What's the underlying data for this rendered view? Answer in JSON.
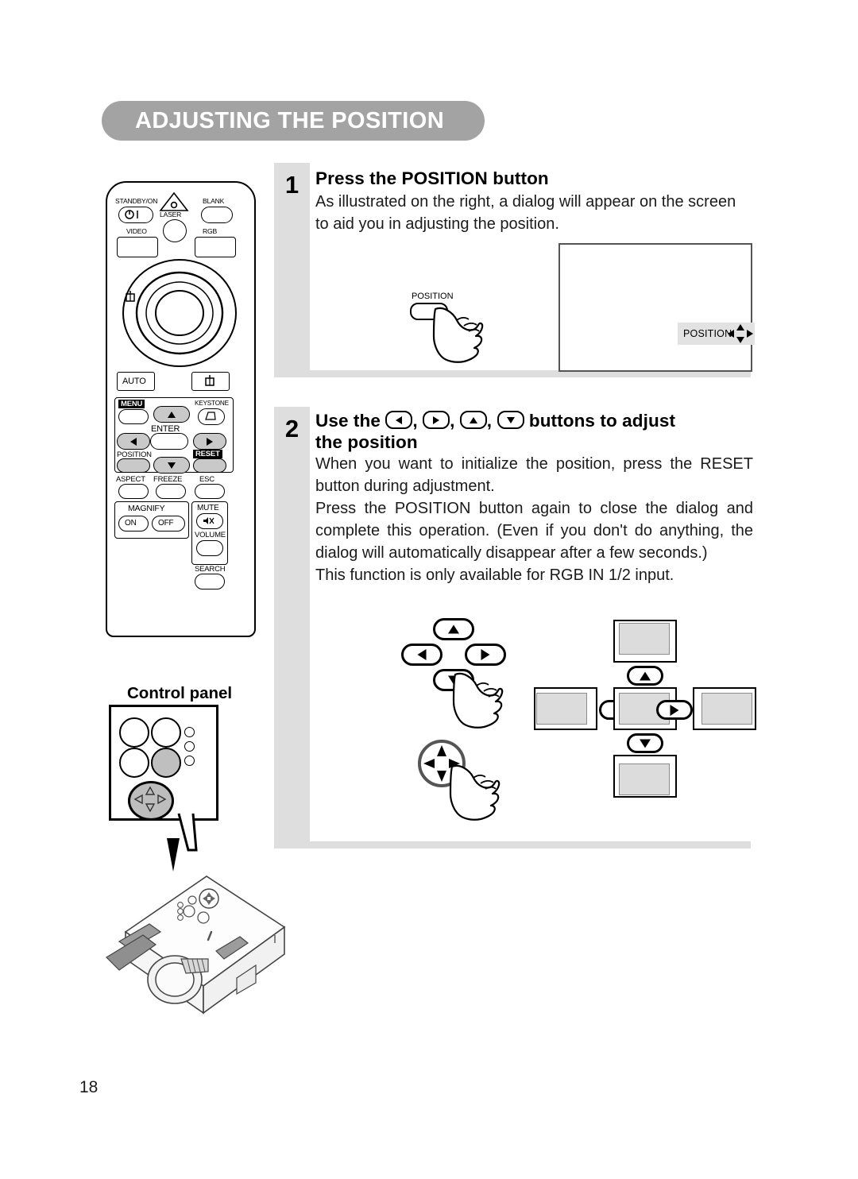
{
  "page": {
    "title": "ADJUSTING THE POSITION",
    "number": "18"
  },
  "steps": [
    {
      "number": "1",
      "heading": "Press the POSITION button",
      "body": [
        "As illustrated on the right, a dialog will appear on the screen to aid you in adjusting the position."
      ]
    },
    {
      "number": "2",
      "heading_parts": {
        "before": "Use the",
        "keys": [
          "left-arrow-key",
          "right-arrow-key",
          "up-arrow-key",
          "down-arrow-key"
        ],
        "after": "buttons to adjust",
        "line2": "the position"
      },
      "body": [
        "When you want to initialize the position, press the RESET button during adjustment.",
        "Press the POSITION button again to close the dialog and complete this operation.  (Even if you don't do anything, the dialog will automatically disappear after a few seconds.)",
        "This function is only available for RGB IN 1/2 input."
      ]
    }
  ],
  "figures": {
    "step1": {
      "hand_button_label": "POSITION",
      "dialog": {
        "badge_label": "POSITION",
        "badge_icon": "four-way-arrow-icon"
      }
    },
    "step2": {
      "remote_keys": [
        "up-arrow-key",
        "left-arrow-key",
        "right-arrow-key",
        "down-arrow-key"
      ],
      "control_pad": "four-way-disc-pad",
      "screen_shift_keys": {
        "up": "up-arrow-key",
        "left": "left-arrow-key",
        "right": "right-arrow-key",
        "down": "down-arrow-key"
      }
    }
  },
  "control_panel": {
    "title": "Control panel"
  },
  "remote": {
    "labels": {
      "standby_on": "STANDBY/ON",
      "laser": "LASER",
      "blank": "BLANK",
      "video": "VIDEO",
      "rgb": "RGB",
      "auto": "AUTO",
      "menu": "MENU",
      "keystone": "KEYSTONE",
      "enter": "ENTER",
      "position": "POSITION",
      "reset": "RESET",
      "aspect": "ASPECT",
      "freeze": "FREEZE",
      "esc": "ESC",
      "magnify": "MAGNIFY",
      "magnify_on": "ON",
      "magnify_off": "OFF",
      "mute": "MUTE",
      "volume": "VOLUME",
      "search": "SEARCH"
    }
  },
  "colors": {
    "banner": "#a3a3a3",
    "step_column": "#dedede",
    "badge": "#e2e2e2",
    "screen_fill": "#dcdcdc"
  }
}
